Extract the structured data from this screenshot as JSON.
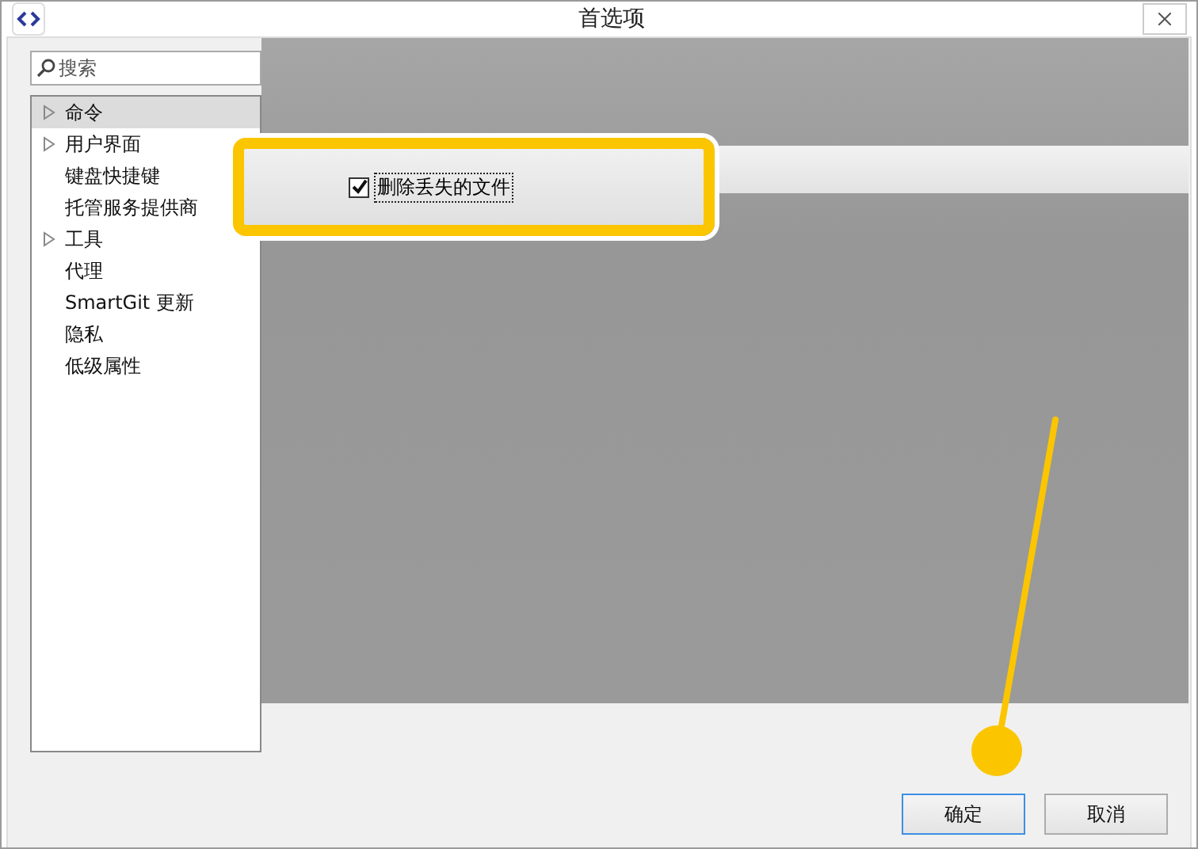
{
  "window": {
    "title": "首选项"
  },
  "search": {
    "placeholder": "搜索"
  },
  "tree": [
    {
      "label": "命令",
      "expandable": true,
      "selected": true
    },
    {
      "label": "用户界面",
      "expandable": true,
      "selected": false
    },
    {
      "label": "键盘快捷键",
      "expandable": false,
      "selected": false
    },
    {
      "label": "托管服务提供商",
      "expandable": false,
      "selected": false
    },
    {
      "label": "工具",
      "expandable": true,
      "selected": false
    },
    {
      "label": "代理",
      "expandable": false,
      "selected": false
    },
    {
      "label": "SmartGit 更新",
      "expandable": false,
      "selected": false
    },
    {
      "label": "隐私",
      "expandable": false,
      "selected": false
    },
    {
      "label": "低级属性",
      "expandable": false,
      "selected": false
    }
  ],
  "highlighted_option": {
    "label": "删除丢失的文件",
    "checked": true
  },
  "buttons": [
    {
      "label": "确定",
      "default": true
    },
    {
      "label": "取消",
      "default": false
    }
  ]
}
